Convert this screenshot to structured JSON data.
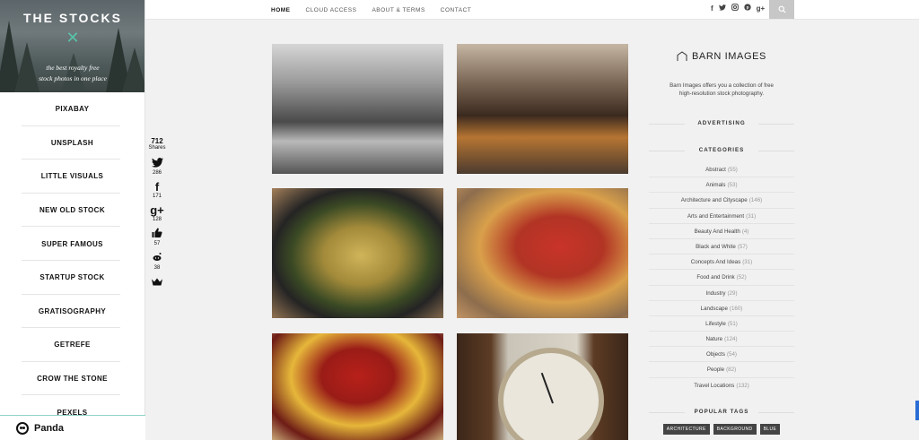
{
  "brand": {
    "title": "THE STOCKS",
    "tagline_line1": "the best royalty free",
    "tagline_line2": "stock photos in one place"
  },
  "sidebar": {
    "items": [
      {
        "label": "PIXABAY"
      },
      {
        "label": "UNSPLASH"
      },
      {
        "label": "LITTLE VISUALS"
      },
      {
        "label": "NEW OLD STOCK"
      },
      {
        "label": "SUPER FAMOUS"
      },
      {
        "label": "STARTUP STOCK"
      },
      {
        "label": "GRATISOGRAPHY"
      },
      {
        "label": "GETREFE"
      },
      {
        "label": "CROW THE STONE"
      },
      {
        "label": "PEXELS"
      }
    ]
  },
  "extension": {
    "label": "Panda"
  },
  "share": {
    "count": "712",
    "count_label": "Shares",
    "twitter": {
      "icon": "twitter-icon",
      "count": "286"
    },
    "facebook": {
      "icon": "facebook-icon",
      "count": "171"
    },
    "googleplus": {
      "icon": "googleplus-icon",
      "count": "128"
    },
    "like": {
      "icon": "thumbs-up-icon",
      "count": "57"
    },
    "reddit": {
      "icon": "reddit-icon",
      "count": "38"
    },
    "crown": {
      "icon": "crown-icon"
    }
  },
  "nav": {
    "home": "HOME",
    "cloud": "CLOUD ACCESS",
    "about": "ABOUT & TERMS",
    "contact": "CONTACT"
  },
  "social_icons": [
    "facebook-icon",
    "twitter-icon",
    "instagram-icon",
    "pinterest-icon",
    "googleplus-icon",
    "search-icon"
  ],
  "right": {
    "brand": "BARN IMAGES",
    "description_line1": "Barn Images offers you a collection of free",
    "description_line2": "high-resolution stock photography.",
    "advertising": "ADVERTISING",
    "categories_title": "CATEGORIES",
    "categories": [
      {
        "name": "Abstract",
        "count": "(55)"
      },
      {
        "name": "Animals",
        "count": "(53)"
      },
      {
        "name": "Architecture and Cityscape",
        "count": "(146)"
      },
      {
        "name": "Arts and Entertainment",
        "count": "(31)"
      },
      {
        "name": "Beauty And Health",
        "count": "(4)"
      },
      {
        "name": "Black and White",
        "count": "(57)"
      },
      {
        "name": "Concepts And Ideas",
        "count": "(31)"
      },
      {
        "name": "Food and Drink",
        "count": "(52)"
      },
      {
        "name": "Industry",
        "count": "(29)"
      },
      {
        "name": "Landscape",
        "count": "(160)"
      },
      {
        "name": "Lifestyle",
        "count": "(51)"
      },
      {
        "name": "Nature",
        "count": "(124)"
      },
      {
        "name": "Objects",
        "count": "(54)"
      },
      {
        "name": "People",
        "count": "(82)"
      },
      {
        "name": "Travel Locations",
        "count": "(132)"
      }
    ],
    "tags_title": "POPULAR TAGS",
    "tags": [
      "ARCHITECTURE",
      "BACKGROUND",
      "BLUE"
    ]
  }
}
